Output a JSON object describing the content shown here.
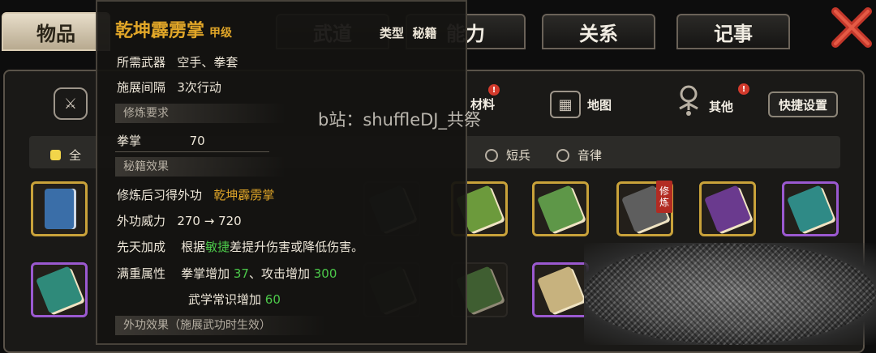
{
  "tabs": [
    {
      "label": "物品",
      "active": true
    },
    {
      "label": "武道"
    },
    {
      "label": "能力"
    },
    {
      "label": "关系"
    },
    {
      "label": "记事"
    }
  ],
  "categories": [
    {
      "label": "材料",
      "icon": "materials-icon",
      "badge": "!"
    },
    {
      "label": "地图",
      "icon": "map-icon"
    },
    {
      "label": "其他",
      "icon": "other-icon",
      "badge": "!"
    }
  ],
  "quick_settings_label": "快捷设置",
  "filters": [
    {
      "label": "全",
      "checked": true
    },
    {
      "label": "短兵"
    },
    {
      "label": "音律"
    }
  ],
  "slot_tag": [
    "修",
    "炼"
  ],
  "watermark": "b站：shuffleDJ_共祭",
  "tooltip": {
    "title": "乾坤霹雳掌",
    "grade": "甲级",
    "type_label": "类型",
    "type_value": "秘籍",
    "req_weapon_label": "所需武器",
    "req_weapon_value": "空手、拳套",
    "interval_label": "施展间隔",
    "interval_value": "3次行动",
    "section_requirements": "修炼要求",
    "fist_label": "拳掌",
    "fist_value": "70",
    "section_effects": "秘籍效果",
    "learned_label": "修炼后习得外功",
    "learned_value": "乾坤霹雳掌",
    "power_label": "外功威力",
    "power_value": "270 → 720",
    "innate_label": "先天加成",
    "innate_prefix": "根据",
    "innate_highlight": "敏捷",
    "innate_suffix": "差提升伤害或降低伤害。",
    "full_label": "满重属性",
    "full_line1_a": "拳掌增加 ",
    "full_line1_a_val": "37",
    "full_line1_b": "、攻击增加 ",
    "full_line1_b_val": "300",
    "full_line2_a": "武学常识增加 ",
    "full_line2_a_val": "60",
    "section_external": "外功效果（施展武功时生效）"
  },
  "colors": {
    "gold": "#e1a628",
    "green": "#4cc94a",
    "red_badge": "#d23a2c",
    "purple_frame": "#9b59d0",
    "gold_frame": "#c9a23a"
  }
}
